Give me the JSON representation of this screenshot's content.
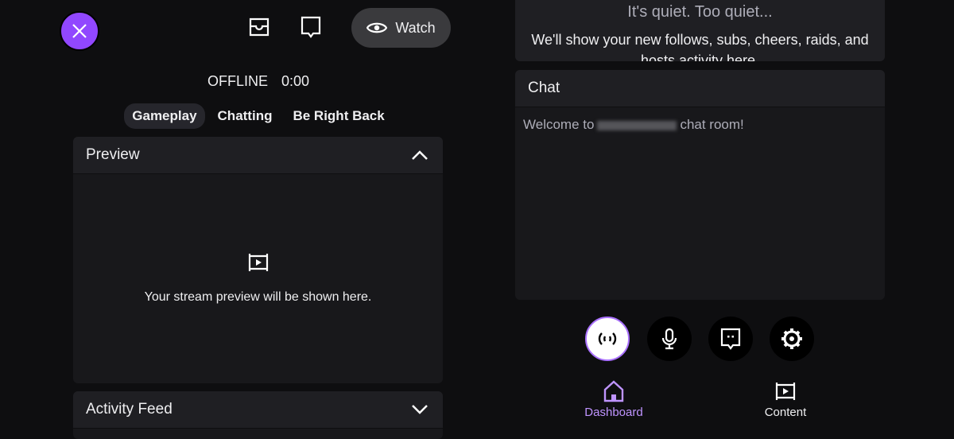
{
  "header": {
    "close_icon": "close-icon",
    "watch_label": "Watch"
  },
  "status": {
    "state": "OFFLINE",
    "time": "0:00"
  },
  "tabs": [
    {
      "label": "Gameplay",
      "active": true
    },
    {
      "label": "Chatting"
    },
    {
      "label": "Be Right Back"
    }
  ],
  "preview": {
    "title": "Preview",
    "message": "Your stream preview will be shown here."
  },
  "activity": {
    "title": "Activity Feed",
    "empty_title": "It's quiet. Too quiet...",
    "empty_text": "We'll show your new follows, subs, cheers, raids, and hosts activity here."
  },
  "chat": {
    "title": "Chat",
    "welcome_prefix": "Welcome to",
    "welcome_suffix": "chat room!"
  },
  "nav": [
    {
      "label": "Dashboard",
      "active": true
    },
    {
      "label": "Content"
    }
  ],
  "colors": {
    "accent": "#9147ff",
    "nav_active": "#bf94ff",
    "background": "#0e0e10",
    "panel": "#1f1f23"
  }
}
